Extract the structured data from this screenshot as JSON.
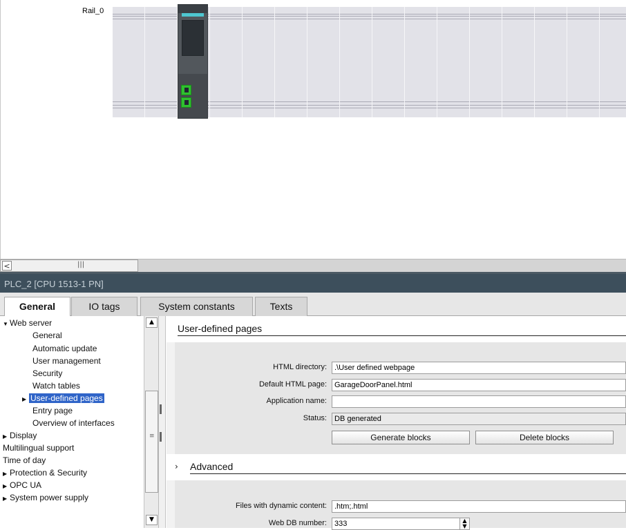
{
  "device_view": {
    "rail_label": "Rail_0"
  },
  "inspector": {
    "title": "PLC_2 [CPU 1513-1 PN]",
    "tabs": [
      {
        "label": "General",
        "active": true
      },
      {
        "label": "IO tags",
        "active": false
      },
      {
        "label": "System constants",
        "active": false
      },
      {
        "label": "Texts",
        "active": false
      }
    ]
  },
  "nav": {
    "items": [
      {
        "label": "Web server",
        "indent": 0,
        "expander": "down"
      },
      {
        "label": "General",
        "indent": 2,
        "expander": ""
      },
      {
        "label": "Automatic update",
        "indent": 2,
        "expander": ""
      },
      {
        "label": "User management",
        "indent": 2,
        "expander": ""
      },
      {
        "label": "Security",
        "indent": 2,
        "expander": ""
      },
      {
        "label": "Watch tables",
        "indent": 2,
        "expander": ""
      },
      {
        "label": "User-defined pages",
        "indent": 1,
        "expander": "right",
        "selected": true
      },
      {
        "label": "Entry page",
        "indent": 2,
        "expander": ""
      },
      {
        "label": "Overview of interfaces",
        "indent": 2,
        "expander": ""
      },
      {
        "label": "Display",
        "indent": 0,
        "expander": "right"
      },
      {
        "label": "Multilingual support",
        "indent": 0,
        "expander": ""
      },
      {
        "label": "Time of day",
        "indent": 0,
        "expander": ""
      },
      {
        "label": "Protection & Security",
        "indent": 0,
        "expander": "right"
      },
      {
        "label": "OPC UA",
        "indent": 0,
        "expander": "right"
      },
      {
        "label": "System power supply",
        "indent": 0,
        "expander": "right"
      }
    ]
  },
  "user_defined_pages": {
    "section_title": "User-defined pages",
    "html_directory_label": "HTML directory:",
    "html_directory_value": ".\\User defined webpage",
    "default_page_label": "Default HTML page:",
    "default_page_value": "GarageDoorPanel.html",
    "app_name_label": "Application name:",
    "app_name_value": "",
    "status_label": "Status:",
    "status_value": "DB generated",
    "generate_button": "Generate blocks",
    "delete_button": "Delete blocks"
  },
  "advanced": {
    "section_title": "Advanced",
    "dynamic_label": "Files with dynamic content:",
    "dynamic_value": ".htm;.html",
    "webdb_label": "Web DB number:",
    "webdb_value": "333"
  },
  "icons": {
    "scroll_left": "scroll-left-arrow-icon",
    "scroll_up": "scroll-up-arrow-icon",
    "scroll_down": "scroll-down-arrow-icon",
    "expand_down": "triangle-down-icon",
    "expand_right": "triangle-right-icon",
    "spinner": "spinner-icon"
  },
  "colors": {
    "inspector_title_bg": "#3d4f5c",
    "selection": "#2f64c8",
    "port_green": "#2fbf2f"
  }
}
